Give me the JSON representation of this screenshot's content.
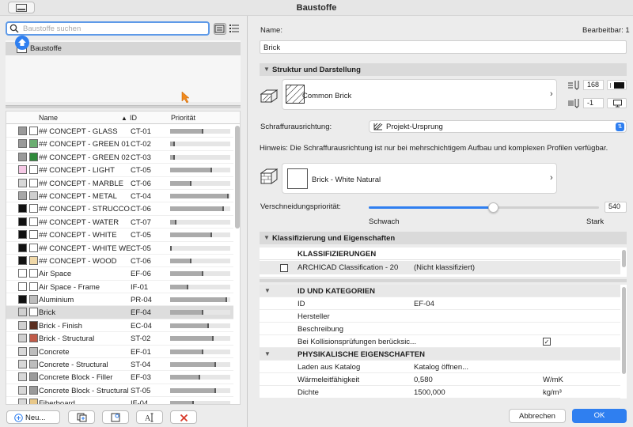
{
  "window": {
    "title": "Baustoffe"
  },
  "search": {
    "placeholder": "Baustoffe suchen"
  },
  "tree": {
    "root_label": "Baustoffe"
  },
  "list": {
    "columns": {
      "name": "Name",
      "id": "ID",
      "priority": "Priorität",
      "sort_indicator": "▲"
    },
    "rows": [
      {
        "name": "## CONCEPT - GLASS",
        "id": "CT-01",
        "priority": 0.55,
        "c1": "#9a9a9a",
        "c2": "#ffffff"
      },
      {
        "name": "## CONCEPT - GREEN 01",
        "id": "CT-02",
        "priority": 0.08,
        "c1": "#9a9a9a",
        "c2": "#6cae72"
      },
      {
        "name": "## CONCEPT - GREEN 02",
        "id": "CT-03",
        "priority": 0.08,
        "c1": "#9a9a9a",
        "c2": "#2f8a3a"
      },
      {
        "name": "## CONCEPT - LIGHT",
        "id": "CT-05",
        "priority": 0.7,
        "c1": "#f6c9e6",
        "c2": "#ffffff"
      },
      {
        "name": "## CONCEPT - MARBLE",
        "id": "CT-06",
        "priority": 0.35,
        "c1": "#d8d8d8",
        "c2": "#ffffff"
      },
      {
        "name": "## CONCEPT - METAL",
        "id": "CT-04",
        "priority": 0.97,
        "c1": "#a8a8a8",
        "c2": "#cfcfcf"
      },
      {
        "name": "## CONCEPT - STRUCCO...",
        "id": "CT-06",
        "priority": 0.9,
        "c1": "#111111",
        "c2": "#ffffff"
      },
      {
        "name": "## CONCEPT - WATER",
        "id": "CT-07",
        "priority": 0.1,
        "c1": "#111111",
        "c2": "#ffffff"
      },
      {
        "name": "## CONCEPT - WHITE",
        "id": "CT-05",
        "priority": 0.7,
        "c1": "#111111",
        "c2": "#ffffff"
      },
      {
        "name": "## CONCEPT - WHITE WE...",
        "id": "CT-05",
        "priority": 0.02,
        "c1": "#111111",
        "c2": "#ffffff"
      },
      {
        "name": "## CONCEPT - WOOD",
        "id": "CT-06",
        "priority": 0.35,
        "c1": "#111111",
        "c2": "#f0d8a8"
      },
      {
        "name": "Air Space",
        "id": "EF-06",
        "priority": 0.55,
        "c1": "#ffffff",
        "c2": "#ffffff"
      },
      {
        "name": "Air Space - Frame",
        "id": "IF-01",
        "priority": 0.3,
        "c1": "#ffffff",
        "c2": "#ffffff"
      },
      {
        "name": "Aluminium",
        "id": "PR-04",
        "priority": 0.95,
        "c1": "#111111",
        "c2": "#bdbdbd"
      },
      {
        "name": "Brick",
        "id": "EF-04",
        "priority": 0.55,
        "c1": "#d0d0d0",
        "c2": "#ffffff"
      },
      {
        "name": "Brick - Finish",
        "id": "EC-04",
        "priority": 0.65,
        "c1": "#d0d0d0",
        "c2": "#5a2e20"
      },
      {
        "name": "Brick - Structural",
        "id": "ST-02",
        "priority": 0.72,
        "c1": "#d0d0d0",
        "c2": "#c05a48"
      },
      {
        "name": "Concrete",
        "id": "EF-01",
        "priority": 0.55,
        "c1": "#d8d8d8",
        "c2": "#bdbdbd"
      },
      {
        "name": "Concrete - Structural",
        "id": "ST-04",
        "priority": 0.76,
        "c1": "#d8d8d8",
        "c2": "#bdbdbd"
      },
      {
        "name": "Concrete Block - Filler",
        "id": "EF-03",
        "priority": 0.5,
        "c1": "#d8d8d8",
        "c2": "#9a9a9a"
      },
      {
        "name": "Concrete Block - Structural",
        "id": "ST-05",
        "priority": 0.76,
        "c1": "#d8d8d8",
        "c2": "#9a9a9a"
      },
      {
        "name": "Fiberboard",
        "id": "IF-04",
        "priority": 0.4,
        "c1": "#d8d8d8",
        "c2": "#e8c88a"
      }
    ],
    "selected_index": 14
  },
  "bottom_buttons": {
    "new_label": "Neu..."
  },
  "detail": {
    "name_label": "Name:",
    "editable_label": "Bearbeitbar: 1",
    "name_value": "Brick",
    "section_structure": "Struktur und Darstellung",
    "fill_name": "Common Brick",
    "pen_value": "168",
    "bg_value": "-1",
    "hatch_label": "Schraffurausrichtung:",
    "hatch_value": "Projekt-Ursprung",
    "hint": "Hinweis: Die Schraffurausrichtung ist nur bei mehrschichtigem Aufbau und komplexen Profilen verfügbar.",
    "surface_name": "Brick - White Natural",
    "priority_label": "Verschneidungspriorität:",
    "priority_value": "540",
    "priority_fraction": 0.54,
    "weak_label": "Schwach",
    "strong_label": "Stark",
    "section_classification": "Klassifizierung und Eigenschaften",
    "class_header": "KLASSIFIZIERUNGEN",
    "class_system": "ARCHICAD Classification - 20",
    "class_value": "(Nicht klassifiziert)"
  },
  "properties": [
    {
      "type": "header",
      "name": "ID UND KATEGORIEN"
    },
    {
      "type": "row",
      "name": "ID",
      "value": "EF-04",
      "unit": ""
    },
    {
      "type": "row",
      "name": "Hersteller",
      "value": "",
      "unit": ""
    },
    {
      "type": "row",
      "name": "Beschreibung",
      "value": "",
      "unit": ""
    },
    {
      "type": "check",
      "name": "Bei Kollisionsprüfungen berücksic...",
      "checked": true
    },
    {
      "type": "header",
      "name": "PHYSIKALISCHE EIGENSCHAFTEN"
    },
    {
      "type": "row",
      "name": "Laden aus Katalog",
      "value": "Katalog öffnen...",
      "unit": ""
    },
    {
      "type": "row",
      "name": "Wärmeleitfähigkeit",
      "value": "0,580",
      "unit": "W/mK"
    },
    {
      "type": "row",
      "name": "Dichte",
      "value": "1500,000",
      "unit": "kg/m³"
    }
  ],
  "footer": {
    "cancel": "Abbrechen",
    "ok": "OK"
  },
  "colors": {
    "accent": "#2f7ff0",
    "selection": "#dddddd",
    "section_bg": "#dadada"
  }
}
